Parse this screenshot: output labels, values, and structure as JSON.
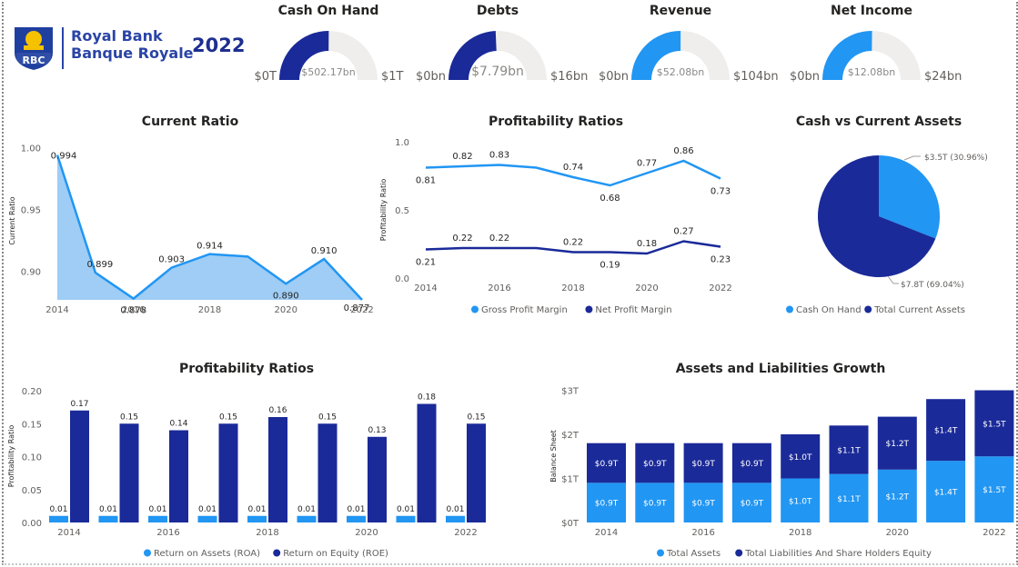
{
  "brand": {
    "logo_text": "RBC",
    "line1": "Royal Bank",
    "line2": "Banque Royale",
    "year": "2022",
    "colors": {
      "brand_blue": "#1f3f9f",
      "logo_yellow": "#f6c200"
    }
  },
  "colors": {
    "dark": "#1a2a99",
    "light": "#2196f3",
    "area_fill": "#9fcdf5",
    "gauge_bg": "#efeeec"
  },
  "gauges": [
    {
      "title": "Cash On Hand",
      "value_label": "$502.17bn",
      "min_label": "$0T",
      "max_label": "$1T",
      "value": 0.50217,
      "max": 1,
      "color": "dark"
    },
    {
      "title": "Debts",
      "value_label": "$7.79bn",
      "min_label": "$0bn",
      "max_label": "$16bn",
      "value": 7.79,
      "max": 16,
      "color": "dark"
    },
    {
      "title": "Revenue",
      "value_label": "$52.08bn",
      "min_label": "$0bn",
      "max_label": "$104bn",
      "value": 52.08,
      "max": 104,
      "color": "light"
    },
    {
      "title": "Net Income",
      "value_label": "$12.08bn",
      "min_label": "$0bn",
      "max_label": "$24bn",
      "value": 12.08,
      "max": 24,
      "color": "light"
    }
  ],
  "chart_data": [
    {
      "id": "current_ratio",
      "type": "area",
      "title": "Current Ratio",
      "ylabel": "Current Ratio",
      "x": [
        2014,
        2015,
        2016,
        2017,
        2018,
        2019,
        2020,
        2021,
        2022
      ],
      "values": [
        0.994,
        0.899,
        0.878,
        0.903,
        0.914,
        0.912,
        0.89,
        0.91,
        0.877
      ],
      "data_labels": [
        "0.994",
        "0.899",
        "0.878",
        "0.903",
        "0.914",
        "",
        "0.890",
        "0.910",
        "0.877"
      ],
      "yticks": [
        "1.00",
        "0.95",
        "0.90"
      ],
      "ytick_values": [
        1.0,
        0.95,
        0.9
      ],
      "xticks": [
        "2014",
        "2016",
        "2018",
        "2020",
        "2022"
      ],
      "ylim": [
        0.877,
        1.0
      ]
    },
    {
      "id": "profitability_margins",
      "type": "line",
      "title": "Profitability Ratios",
      "ylabel": "Profitability Ratio",
      "x": [
        2014,
        2015,
        2016,
        2017,
        2018,
        2019,
        2020,
        2021,
        2022
      ],
      "series": [
        {
          "name": "Gross Profit Margin",
          "color": "light",
          "values": [
            0.81,
            0.82,
            0.83,
            0.81,
            0.74,
            0.68,
            0.77,
            0.86,
            0.73
          ],
          "data_labels": [
            "0.81",
            "0.82",
            "0.83",
            "",
            "0.74",
            "0.68",
            "0.77",
            "0.86",
            "0.73"
          ]
        },
        {
          "name": "Net Profit Margin",
          "color": "dark",
          "values": [
            0.21,
            0.22,
            0.22,
            0.22,
            0.19,
            0.19,
            0.18,
            0.27,
            0.23
          ],
          "data_labels": [
            "0.21",
            "0.22",
            "0.22",
            "",
            "0.22",
            "0.19",
            "0.18",
            "0.27",
            "0.23"
          ]
        }
      ],
      "yticks": [
        "1.0",
        "0.5",
        "0.0"
      ],
      "ytick_values": [
        1.0,
        0.5,
        0.0
      ],
      "xticks": [
        "2014",
        "2016",
        "2018",
        "2020",
        "2022"
      ],
      "ylim": [
        0,
        1.0
      ],
      "legend": "bottom"
    },
    {
      "id": "cash_vs_assets",
      "type": "pie",
      "title": "Cash vs Current Assets",
      "slices": [
        {
          "name": "Cash On Hand",
          "value": 3.5,
          "label": "$3.5T (30.96%)",
          "color": "light"
        },
        {
          "name": "Total Current Assets",
          "value": 7.8,
          "label": "$7.8T (69.04%)",
          "color": "dark"
        }
      ],
      "legend": "bottom"
    },
    {
      "id": "return_ratios",
      "type": "bar",
      "title": "Profitability Ratios",
      "ylabel": "Profitability Ratio",
      "categories": [
        2014,
        2015,
        2016,
        2017,
        2018,
        2019,
        2020,
        2021,
        2022
      ],
      "series": [
        {
          "name": "Return on Assets (ROA)",
          "color": "light",
          "values": [
            0.01,
            0.01,
            0.01,
            0.01,
            0.01,
            0.01,
            0.01,
            0.01,
            0.01
          ],
          "data_labels": [
            "0.01",
            "0.01",
            "0.01",
            "0.01",
            "0.01",
            "0.01",
            "0.01",
            "0.01",
            "0.01"
          ]
        },
        {
          "name": "Return on Equity (ROE)",
          "color": "dark",
          "values": [
            0.17,
            0.15,
            0.14,
            0.15,
            0.16,
            0.15,
            0.13,
            0.18,
            0.15
          ],
          "data_labels": [
            "0.17",
            "0.15",
            "0.14",
            "0.15",
            "0.16",
            "0.15",
            "0.13",
            "0.18",
            "0.15"
          ]
        }
      ],
      "yticks": [
        "0.20",
        "0.15",
        "0.10",
        "0.05",
        "0.00"
      ],
      "ytick_values": [
        0.2,
        0.15,
        0.1,
        0.05,
        0.0
      ],
      "xticks": [
        "2014",
        "2016",
        "2018",
        "2020",
        "2022"
      ],
      "ylim": [
        0,
        0.2
      ],
      "legend": "bottom"
    },
    {
      "id": "assets_liabilities",
      "type": "bar",
      "stacked": true,
      "title": "Assets and Liabilities Growth",
      "ylabel": "Balance Sheet",
      "categories": [
        2014,
        2015,
        2016,
        2017,
        2018,
        2019,
        2020,
        2021,
        2022
      ],
      "series": [
        {
          "name": "Total Assets",
          "color": "light",
          "values": [
            0.9,
            0.9,
            0.9,
            0.9,
            1.0,
            1.1,
            1.2,
            1.4,
            1.5
          ],
          "data_labels": [
            "$0.9T",
            "$0.9T",
            "$0.9T",
            "$0.9T",
            "$1.0T",
            "$1.1T",
            "$1.2T",
            "$1.4T",
            "$1.5T"
          ]
        },
        {
          "name": "Total Liabilities And Share Holders Equity",
          "color": "dark",
          "values": [
            0.9,
            0.9,
            0.9,
            0.9,
            1.0,
            1.1,
            1.2,
            1.4,
            1.5
          ],
          "data_labels": [
            "$0.9T",
            "$0.9T",
            "$0.9T",
            "$0.9T",
            "$1.0T",
            "$1.1T",
            "$1.2T",
            "$1.4T",
            "$1.5T"
          ]
        }
      ],
      "yticks": [
        "$3T",
        "$2T",
        "$1T",
        "$0T"
      ],
      "ytick_values": [
        3,
        2,
        1,
        0
      ],
      "xticks": [
        "2014",
        "2016",
        "2018",
        "2020",
        "2022"
      ],
      "ylim": [
        0,
        3
      ],
      "legend": "bottom"
    }
  ]
}
